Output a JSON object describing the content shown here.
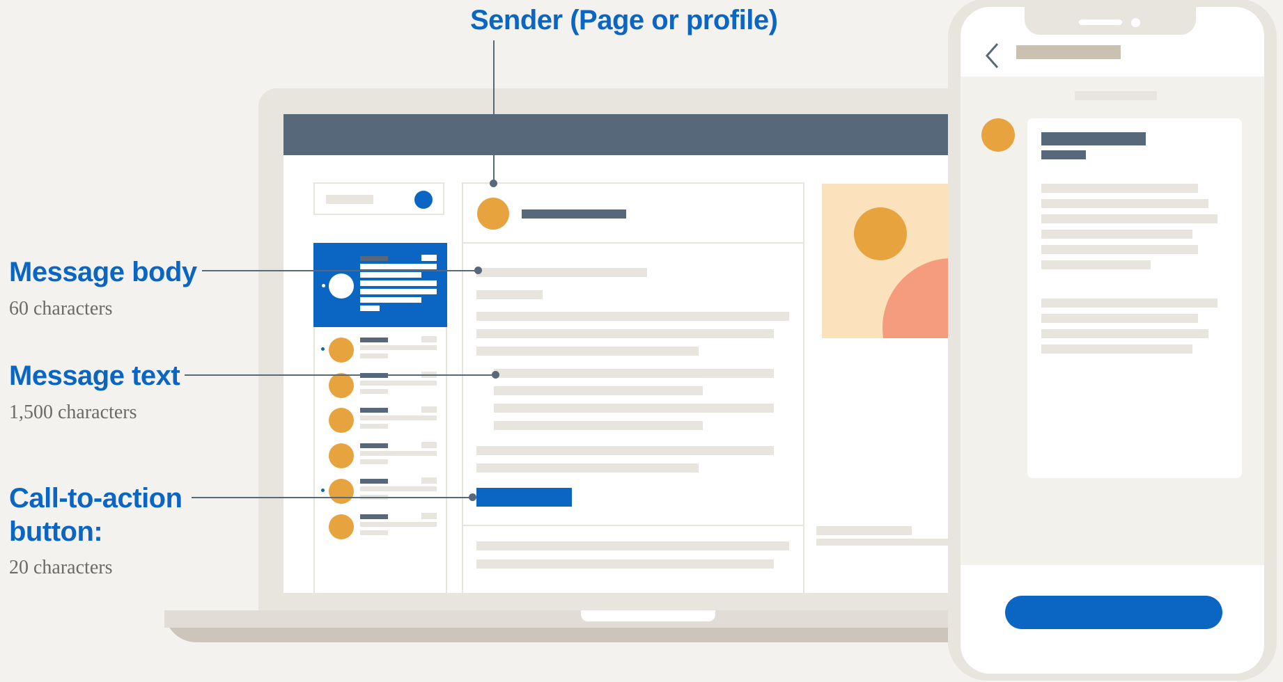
{
  "annotations": {
    "sender": {
      "title": "Sender (Page or profile)"
    },
    "message_body": {
      "title": "Message body",
      "limit": "60 characters"
    },
    "message_text": {
      "title": "Message text",
      "limit": "1,500 characters"
    },
    "cta_button": {
      "title_line1": "Call-to-action",
      "title_line2": "button:",
      "limit": "20 characters"
    }
  },
  "colors": {
    "accent_blue": "#0a66c2",
    "sender_orange": "#e7a33e",
    "header_slate": "#56687a",
    "peach": "#fbe2bc",
    "salmon": "#f59b7e",
    "background": "#f4f2ee"
  },
  "icons": {
    "phone_back": "chevron-left-icon",
    "notification_dot": "blue-dot-icon"
  }
}
